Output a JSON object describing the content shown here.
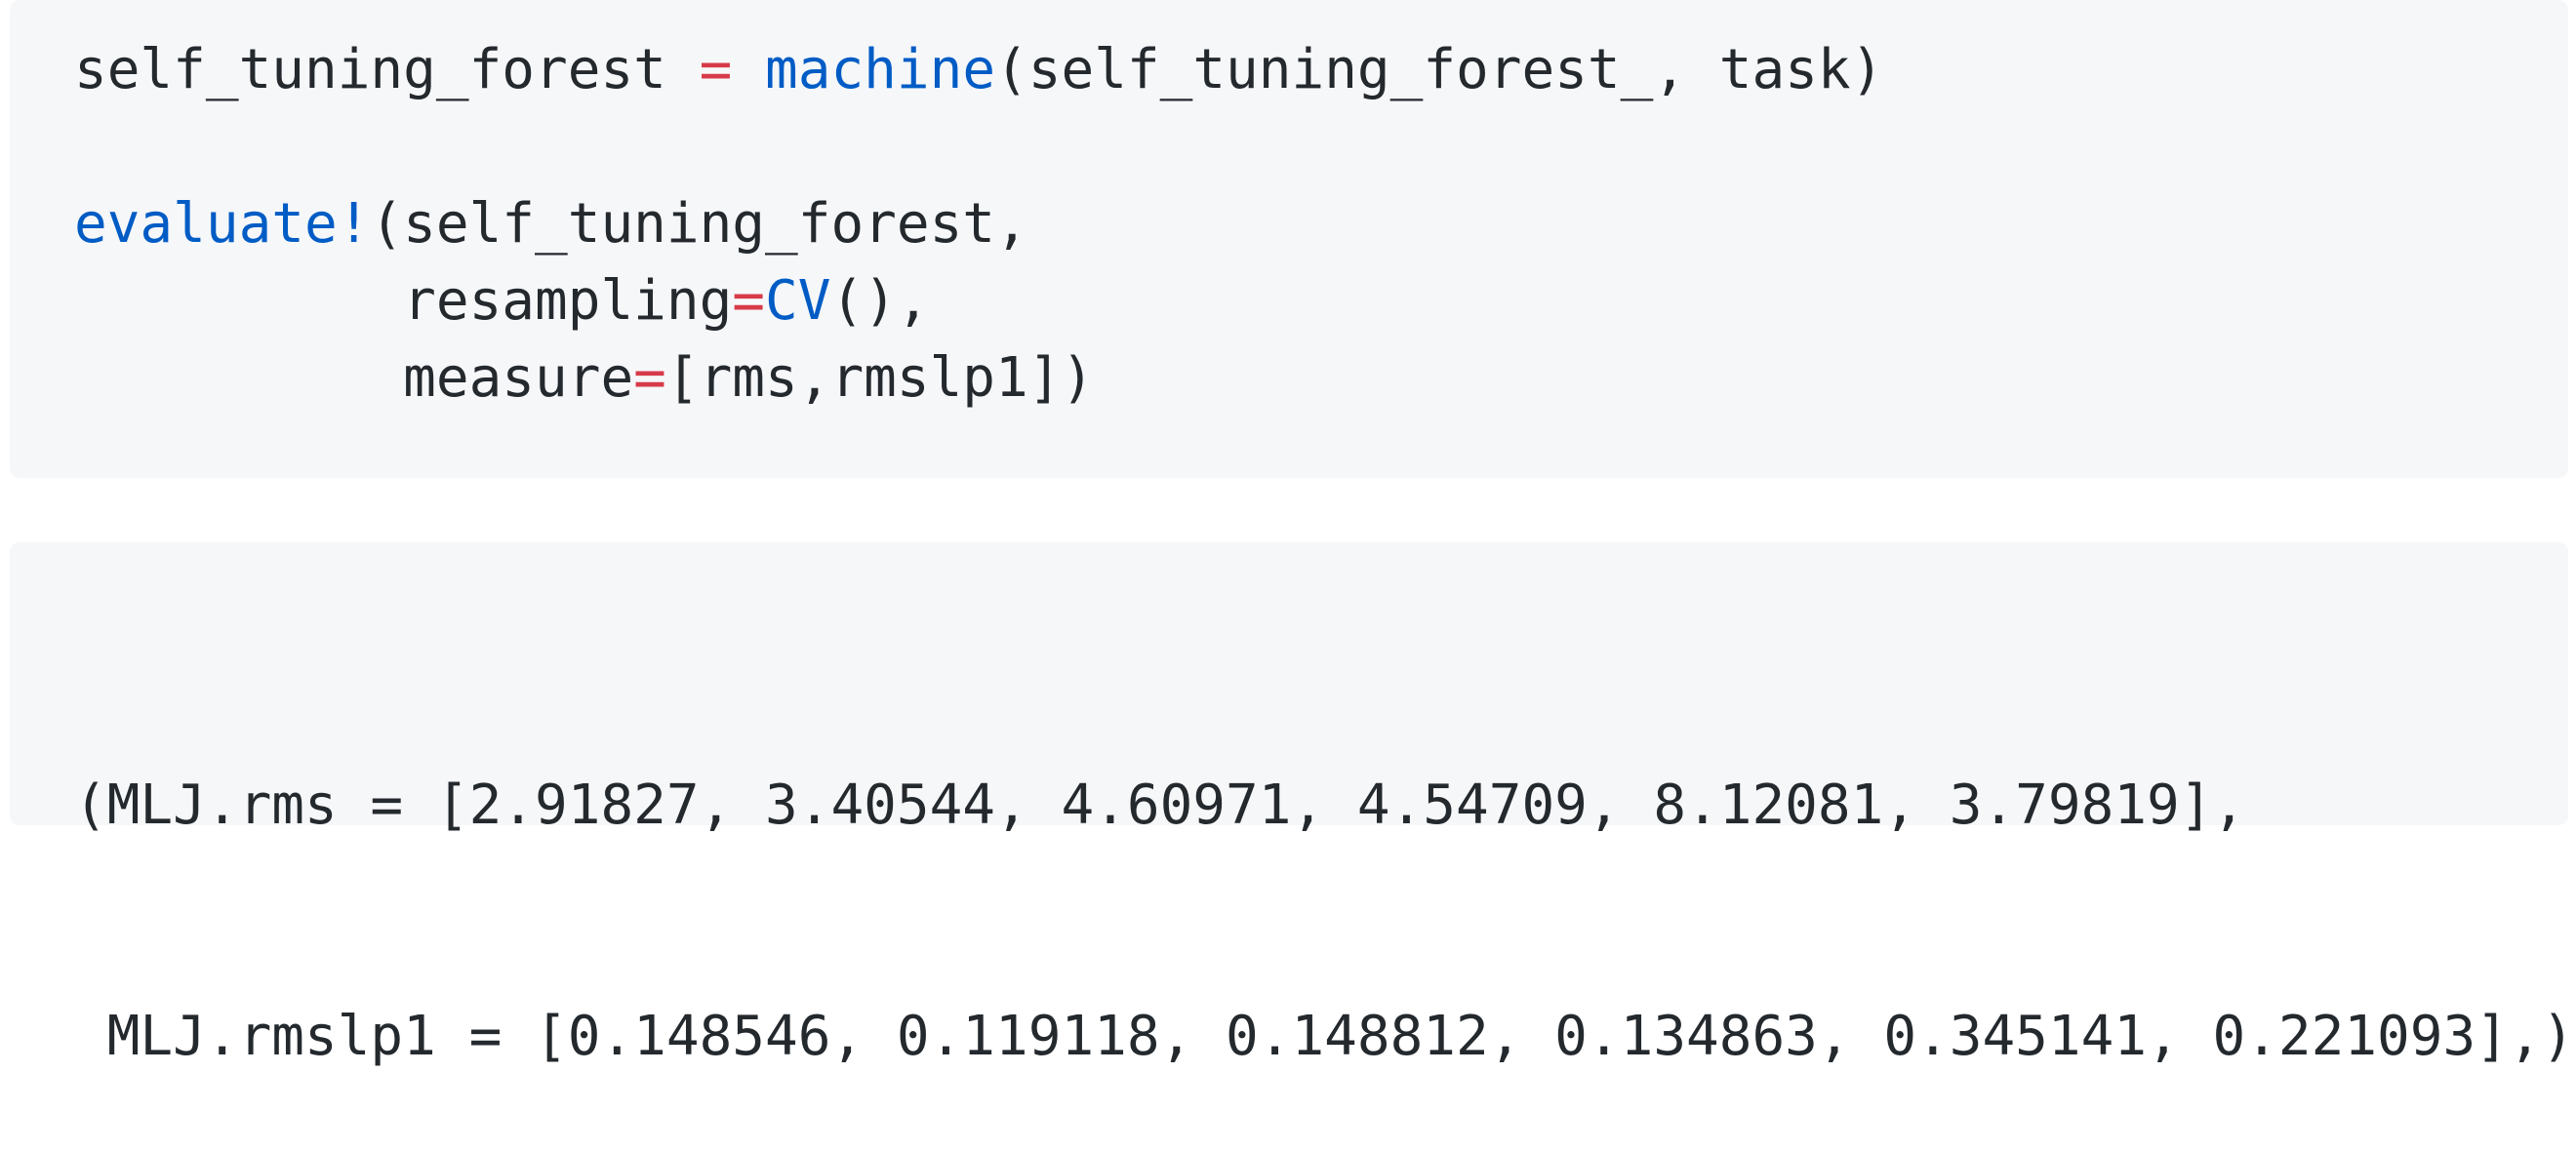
{
  "code_input": {
    "lines": [
      [
        {
          "t": "self_tuning_forest ",
          "k": "plain"
        },
        {
          "t": "=",
          "k": "op"
        },
        {
          "t": " ",
          "k": "plain"
        },
        {
          "t": "machine",
          "k": "fn"
        },
        {
          "t": "(self_tuning_forest_, task)",
          "k": "plain"
        }
      ],
      [],
      [
        {
          "t": "evaluate!",
          "k": "fn"
        },
        {
          "t": "(self_tuning_forest,",
          "k": "plain"
        }
      ],
      [
        {
          "t": "          resampling",
          "k": "plain"
        },
        {
          "t": "=",
          "k": "op"
        },
        {
          "t": "CV",
          "k": "fn"
        },
        {
          "t": "(),",
          "k": "plain"
        }
      ],
      [
        {
          "t": "          measure",
          "k": "plain"
        },
        {
          "t": "=",
          "k": "op"
        },
        {
          "t": "[rms,rmslp1])",
          "k": "plain"
        }
      ]
    ]
  },
  "code_output": {
    "lines": [
      "(MLJ.rms = [2.91827, 3.40544, 4.60971, 4.54709, 8.12081, 3.79819],",
      " MLJ.rmslp1 = [0.148546, 0.119118, 0.148812, 0.134863, 0.345141, 0.221093],)"
    ]
  },
  "colors": {
    "background": "#ffffff",
    "code_background": "#f6f7f9",
    "text": "#24292e",
    "operator": "#d73a49",
    "function": "#005cc5"
  }
}
